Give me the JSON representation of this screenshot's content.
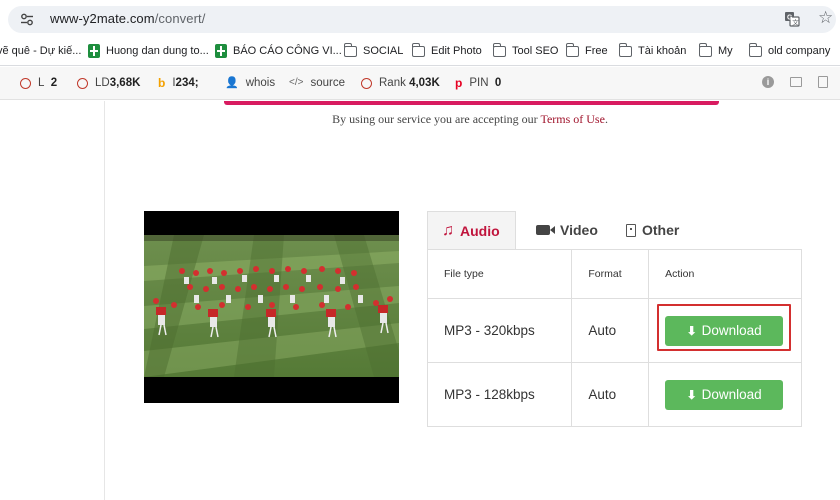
{
  "browser": {
    "url_host": "www-y2mate.com",
    "url_path": "/convert/"
  },
  "bookmarks": [
    {
      "label": "vẽ quê - Dự kiế...",
      "icon": "none"
    },
    {
      "label": "Huong dan dung to...",
      "icon": "sheets-icon"
    },
    {
      "label": "BÁO CÁO CÔNG VI...",
      "icon": "sheets-icon"
    },
    {
      "label": "SOCIAL",
      "icon": "folder-icon"
    },
    {
      "label": "Edit Photo",
      "icon": "folder-icon"
    },
    {
      "label": "Tool SEO",
      "icon": "folder-icon"
    },
    {
      "label": "Free",
      "icon": "folder-icon"
    },
    {
      "label": "Tài khoản",
      "icon": "folder-icon"
    },
    {
      "label": "My",
      "icon": "folder-icon"
    },
    {
      "label": "old company",
      "icon": "folder-icon"
    }
  ],
  "seo_toolbar": {
    "l_label": "L",
    "l_value": "2",
    "ld_label": "LD",
    "ld_value": "3,68K",
    "i_label": "I",
    "i_value": "234;",
    "whois_label": "whois",
    "source_label": "source",
    "rank_label": "Rank",
    "rank_value": "4,03K",
    "pin_label": "PIN",
    "pin_value": "0"
  },
  "page": {
    "terms_prefix": "By using our service you are accepting our ",
    "terms_link": "Terms of Use",
    "terms_suffix": "."
  },
  "tabs": [
    {
      "label": "Audio",
      "active": true
    },
    {
      "label": "Video",
      "active": false
    },
    {
      "label": "Other",
      "active": false
    }
  ],
  "table": {
    "headers": [
      "File type",
      "Format",
      "Action"
    ],
    "rows": [
      {
        "file_type": "MP3 - 320kbps",
        "format": "Auto",
        "action": "Download",
        "highlighted": true
      },
      {
        "file_type": "MP3 - 128kbps",
        "format": "Auto",
        "action": "Download",
        "highlighted": false
      }
    ]
  },
  "colors": {
    "accent": "#c0143c",
    "download_button": "#5cb85c",
    "highlight_box": "#d32f2f"
  }
}
